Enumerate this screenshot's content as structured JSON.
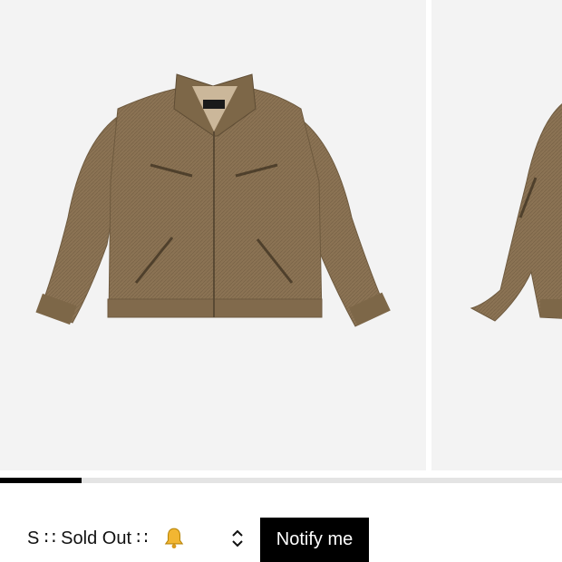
{
  "gallery": {
    "images": [
      {
        "alt": "jacket-front-view"
      },
      {
        "alt": "jacket-side-view"
      }
    ],
    "progress_fraction": 0.145,
    "colors": {
      "background": "#f3f3f3",
      "jacket": "#8b7354",
      "indicator": "#000000",
      "track": "#e4e4e4"
    }
  },
  "purchase": {
    "size_option": "S ∷ Sold Out ∷ ",
    "bell_icon": "bell-icon",
    "chevron_icon": "chevron-updown-icon",
    "notify_label": "Notify me"
  }
}
